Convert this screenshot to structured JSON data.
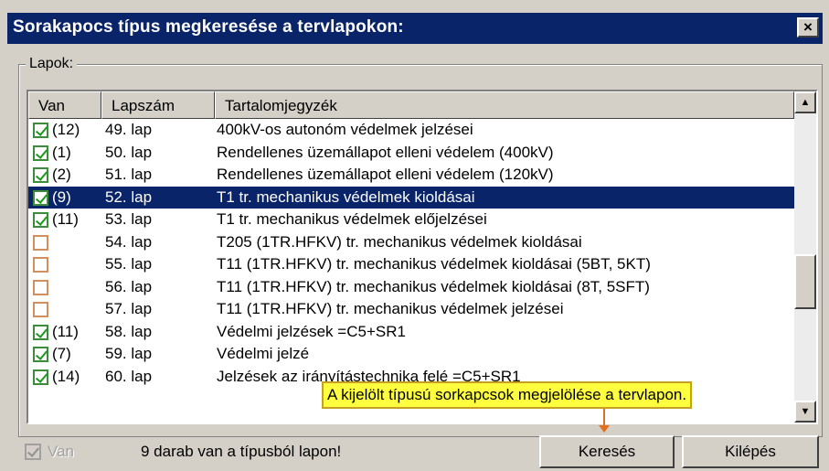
{
  "window": {
    "title": "Sorakapocs típus megkeresése a tervlapokon:",
    "close_label": "×"
  },
  "group": {
    "label": "Lapok:"
  },
  "columns": {
    "van": "Van",
    "lap": "Lapszám",
    "tart": "Tartalomjegyzék"
  },
  "rows": [
    {
      "checked": true,
      "count": "(12)",
      "lap": "49. lap",
      "desc": "400kV-os autonóm védelmek jelzései",
      "selected": false
    },
    {
      "checked": true,
      "count": "(1)",
      "lap": "50. lap",
      "desc": "Rendellenes üzemállapot elleni védelem (400kV)",
      "selected": false
    },
    {
      "checked": true,
      "count": "(2)",
      "lap": "51. lap",
      "desc": "Rendellenes üzemállapot elleni védelem (120kV)",
      "selected": false
    },
    {
      "checked": true,
      "count": "(9)",
      "lap": "52. lap",
      "desc": "T1 tr. mechanikus védelmek kioldásai",
      "selected": true
    },
    {
      "checked": true,
      "count": "(11)",
      "lap": "53. lap",
      "desc": "T1 tr. mechanikus védelmek előjelzései",
      "selected": false
    },
    {
      "checked": false,
      "count": "",
      "lap": "54. lap",
      "desc": "T205 (1TR.HFKV) tr. mechanikus védelmek kioldásai",
      "selected": false
    },
    {
      "checked": false,
      "count": "",
      "lap": "55. lap",
      "desc": "T11 (1TR.HFKV) tr. mechanikus védelmek kioldásai (5BT, 5KT)",
      "selected": false
    },
    {
      "checked": false,
      "count": "",
      "lap": "56. lap",
      "desc": "T11 (1TR.HFKV) tr. mechanikus védelmek kioldásai (8T, 5SFT)",
      "selected": false
    },
    {
      "checked": false,
      "count": "",
      "lap": "57. lap",
      "desc": "T11 (1TR.HFKV) tr. mechanikus védelmek jelzései",
      "selected": false
    },
    {
      "checked": true,
      "count": "(11)",
      "lap": "58. lap",
      "desc": "Védelmi jelzések =C5+SR1",
      "selected": false
    },
    {
      "checked": true,
      "count": "(7)",
      "lap": "59. lap",
      "desc": "Védelmi jelzé",
      "selected": false
    },
    {
      "checked": true,
      "count": "(14)",
      "lap": "60. lap",
      "desc": "Jelzések az irányítástechnika felé =C5+SR1",
      "selected": false
    }
  ],
  "scrollbar": {
    "up_label": "▲",
    "down_label": "▼"
  },
  "tooltip": "A kijelölt típusú sorkapcsok megjelölése a tervlapon.",
  "bottom": {
    "van_checkbox_label": "Van",
    "status": "9 darab van a típusból lapon!",
    "search_label": "Keresés",
    "exit_label": "Kilépés"
  },
  "colors": {
    "title_bar": "#0a246a",
    "selection": "#0a246a",
    "tooltip": "#ffff40",
    "arrow": "#e07020"
  }
}
